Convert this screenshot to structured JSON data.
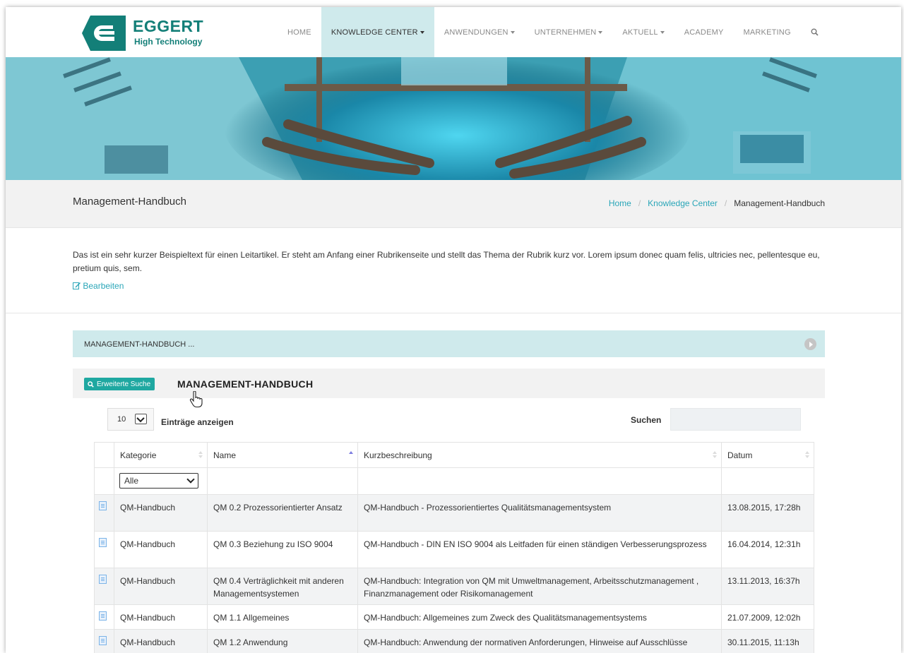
{
  "brand": {
    "name": "EGGERT",
    "tagline": "High Technology",
    "color": "#137f78"
  },
  "nav": {
    "items": [
      {
        "label": "HOME",
        "dropdown": false,
        "active": false
      },
      {
        "label": "KNOWLEDGE CENTER",
        "dropdown": true,
        "active": true
      },
      {
        "label": "ANWENDUNGEN",
        "dropdown": true,
        "active": false
      },
      {
        "label": "UNTERNEHMEN",
        "dropdown": true,
        "active": false
      },
      {
        "label": "AKTUELL",
        "dropdown": true,
        "active": false
      },
      {
        "label": "ACADEMY",
        "dropdown": false,
        "active": false
      },
      {
        "label": "MARKETING",
        "dropdown": false,
        "active": false
      }
    ],
    "search_icon": "search-icon",
    "active_bg": "#cfeaec"
  },
  "page": {
    "title": "Management-Handbuch",
    "breadcrumb": [
      "Home",
      "Knowledge Center",
      "Management-Handbuch"
    ]
  },
  "intro": {
    "text": "Das ist ein sehr kurzer Beispieltext für einen Leitartikel. Er steht am Anfang einer Rubrikenseite und stellt das Thema der Rubrik kurz vor. Lorem ipsum donec quam felis, ultricies nec, pellentesque eu, pretium quis, sem.",
    "edit_label": "Bearbeiten"
  },
  "panel": {
    "title": "MANAGEMENT-HANDBUCH ..."
  },
  "listing": {
    "advanced_search_label": "Erweiterte Suche",
    "title": "MANAGEMENT-HANDBUCH",
    "page_length": "10",
    "page_length_label": "Einträge anzeigen",
    "search_label": "Suchen",
    "search_value": "",
    "columns": [
      "Kategorie",
      "Name",
      "Kurzbeschreibung",
      "Datum"
    ],
    "category_filter": "Alle",
    "rows": [
      {
        "kategorie": "QM-Handbuch",
        "name": "QM 0.2 Prozessorientierter Ansatz",
        "kurz": "QM-Handbuch - Prozessorientiertes Qualitätsmanagementsystem",
        "datum": "13.08.2015, 17:28h"
      },
      {
        "kategorie": "QM-Handbuch",
        "name": "QM 0.3 Beziehung zu ISO 9004",
        "kurz": "QM-Handbuch - DIN EN ISO 9004 als Leitfaden für einen ständigen Verbesserungsprozess",
        "datum": "16.04.2014, 12:31h"
      },
      {
        "kategorie": "QM-Handbuch",
        "name": "QM 0.4 Verträglichkeit mit anderen Managementsystemen",
        "kurz": "QM-Handbuch: Integration von QM mit Umweltmanagement, Arbeitsschutzmanagement , Finanzmanagement oder Risikomanagement",
        "datum": "13.11.2013, 16:37h"
      },
      {
        "kategorie": "QM-Handbuch",
        "name": "QM 1.1 Allgemeines",
        "kurz": "QM-Handbuch: Allgemeines zum Zweck des Qualitätsmanagementsystems",
        "datum": "21.07.2009, 12:02h"
      },
      {
        "kategorie": "QM-Handbuch",
        "name": "QM 1.2 Anwendung",
        "kurz": "QM-Handbuch: Anwendung der normativen Anforderungen, Hinweise auf Ausschlüsse",
        "datum": "30.11.2015, 11:13h"
      }
    ]
  }
}
